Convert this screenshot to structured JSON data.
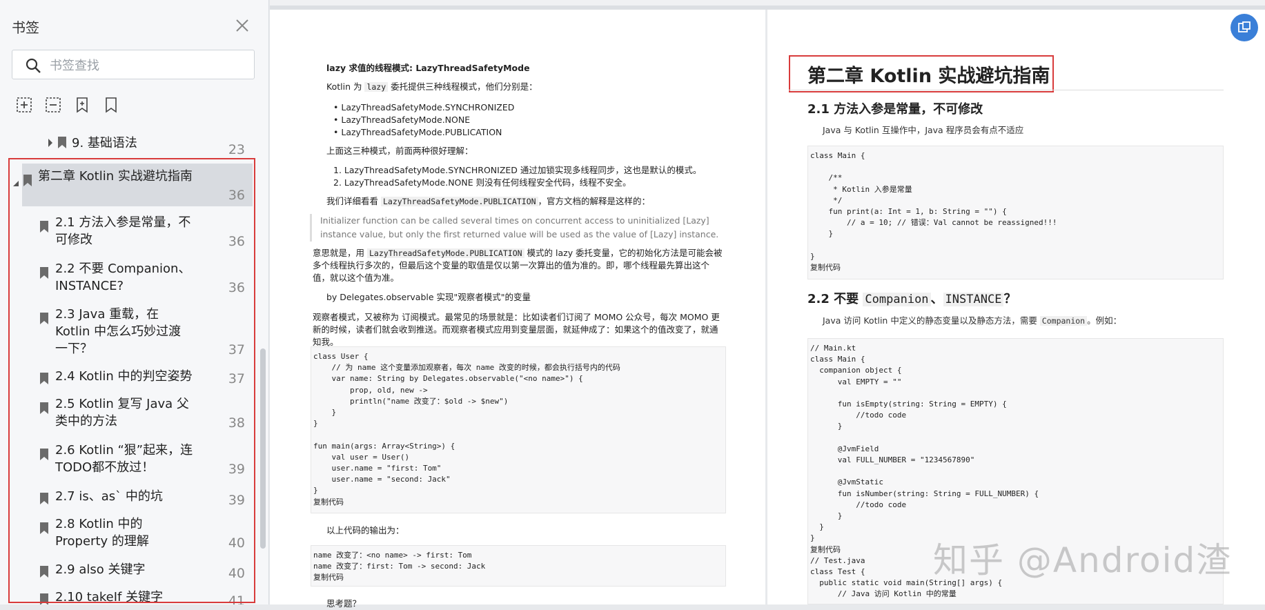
{
  "sidebar": {
    "title": "书签",
    "search_placeholder": "书签查找",
    "items": [
      {
        "label": "9. 基础语法",
        "page": "23"
      },
      {
        "label": "第二章 Kotlin 实战避坑指南",
        "page": "36"
      },
      {
        "label": "2.1 方法入参是常量，不可修改",
        "page": "36"
      },
      {
        "label": "2.2 不要 Companion、INSTANCE?",
        "page": "36"
      },
      {
        "label": "2.3 Java 重载，在 Kotlin 中怎么巧妙过渡一下？",
        "page": "37"
      },
      {
        "label": "2.4 Kotlin 中的判空姿势",
        "page": "37"
      },
      {
        "label": "2.5 Kotlin 复写 Java 父类中的方法",
        "page": "38"
      },
      {
        "label": "2.6 Kotlin “狠”起来，连TODO都不放过！",
        "page": "39"
      },
      {
        "label": "2.7 is、as` 中的坑",
        "page": "39"
      },
      {
        "label": "2.8 Kotlin 中的 Property 的理解",
        "page": "40"
      },
      {
        "label": "2.9 also 关键字",
        "page": "40"
      },
      {
        "label": "2.10 takeIf 关键字",
        "page": "41"
      }
    ]
  },
  "page1": {
    "h_lazy": "lazy 求值的线程模式: LazyThreadSafetyMode",
    "intro_pre": "Kotlin 为 ",
    "intro_code": "lazy",
    "intro_post": " 委托提供三种线程模式，他们分别是：",
    "modes": [
      "LazyThreadSafetyMode.SYNCHRONIZED",
      "LazyThreadSafetyMode.NONE",
      "LazyThreadSafetyMode.PUBLICATION"
    ],
    "understand": "上面这三种模式，前面两种很好理解：",
    "mode_desc": [
      "LazyThreadSafetyMode.SYNCHRONIZED 通过加锁实现多线程同步，这也是默认的模式。",
      "LazyThreadSafetyMode.NONE 则没有任何线程安全代码，线程不安全。"
    ],
    "detail_pre": "我们详细看看 ",
    "detail_code": "LazyThreadSafetyMode.PUBLICATION",
    "detail_post": "，官方文档的解释是这样的：",
    "quote": "Initializer function can be called several times on concurrent access to uninitialized [Lazy] instance value, but only the first returned value will be used as the value of [Lazy] instance.",
    "meaning_pre": "意思就是，用 ",
    "meaning_code": "LazyThreadSafetyMode.PUBLICATION",
    "meaning_post": " 模式的 lazy 委托变量，它的初始化方法是可能会被多个线程执行多次的，但最后这个变量的取值是仅以第一次算出的值为准的。即，哪个线程最先算出这个值，就以这个值为准。",
    "by_delegates": "by Delegates.observable 实现\"观察者模式\"的变量",
    "observer_text": "观察者模式，又被称为 订阅模式。最常见的场景就是：比如读者们订阅了 MOMO 公众号，每次 MOMO 更新的时候，读者们就会收到推送。而观察者模式应用到变量层面，就延伸成了：如果这个的值改变了，就通知我。",
    "code1": "class User {\n    // 为 name 这个变量添加观察者，每次 name 改变的时候，都会执行括号内的代码\n    var name: String by Delegates.observable(\"<no name>\") {\n        prop, old, new ->\n        println(\"name 改变了：$old -> $new\")\n    }\n}\n\nfun main(args: Array<String>) {\n    val user = User()\n    user.name = \"first: Tom\"\n    user.name = \"second: Jack\"\n}\n复制代码",
    "output_label": "以上代码的输出为：",
    "code2": "name 改变了：<no name> -> first: Tom\nname 改变了：first: Tom -> second: Jack\n复制代码",
    "tail": "思考题？"
  },
  "page2": {
    "chapter_title": "第二章 Kotlin 实战避坑指南",
    "h21": "2.1 方法入参是常量，不可修改",
    "p21": "Java 与 Kotlin 互操作中，Java 程序员会有点不适应",
    "code21": "class Main {\n\n    /**\n     * Kotlin 入参是常量\n     */\n    fun print(a: Int = 1, b: String = \"\") {\n        // a = 10; // 错误：Val cannot be reassigned!!!\n    }\n\n}\n复制代码",
    "h22_pre": "2.2 不要 ",
    "h22_code1": "Companion",
    "h22_mid": "、",
    "h22_code2": "INSTANCE",
    "h22_post": "？",
    "p22_pre": "Java 访问 Kotlin 中定义的静态变量以及静态方法，需要 ",
    "p22_code": "Companion",
    "p22_post": "。例如：",
    "code22": "// Main.kt\nclass Main {\n  companion object {\n      val EMPTY = \"\"\n\n      fun isEmpty(string: String = EMPTY) {\n          //todo code\n      }\n\n      @JvmField\n      val FULL_NUMBER = \"1234567890\"\n\n      @JvmStatic\n      fun isNumber(string: String = FULL_NUMBER) {\n          //todo code\n      }\n  }\n}\n复制代码\n// Test.java\nclass Test {\n  public static void main(String[] args) {\n      // Java 访问 Kotlin 中的常量",
    "watermark": "知乎 @Android渣"
  },
  "colors": {
    "accent": "#d83b3b",
    "fab": "#3a7fd8"
  }
}
